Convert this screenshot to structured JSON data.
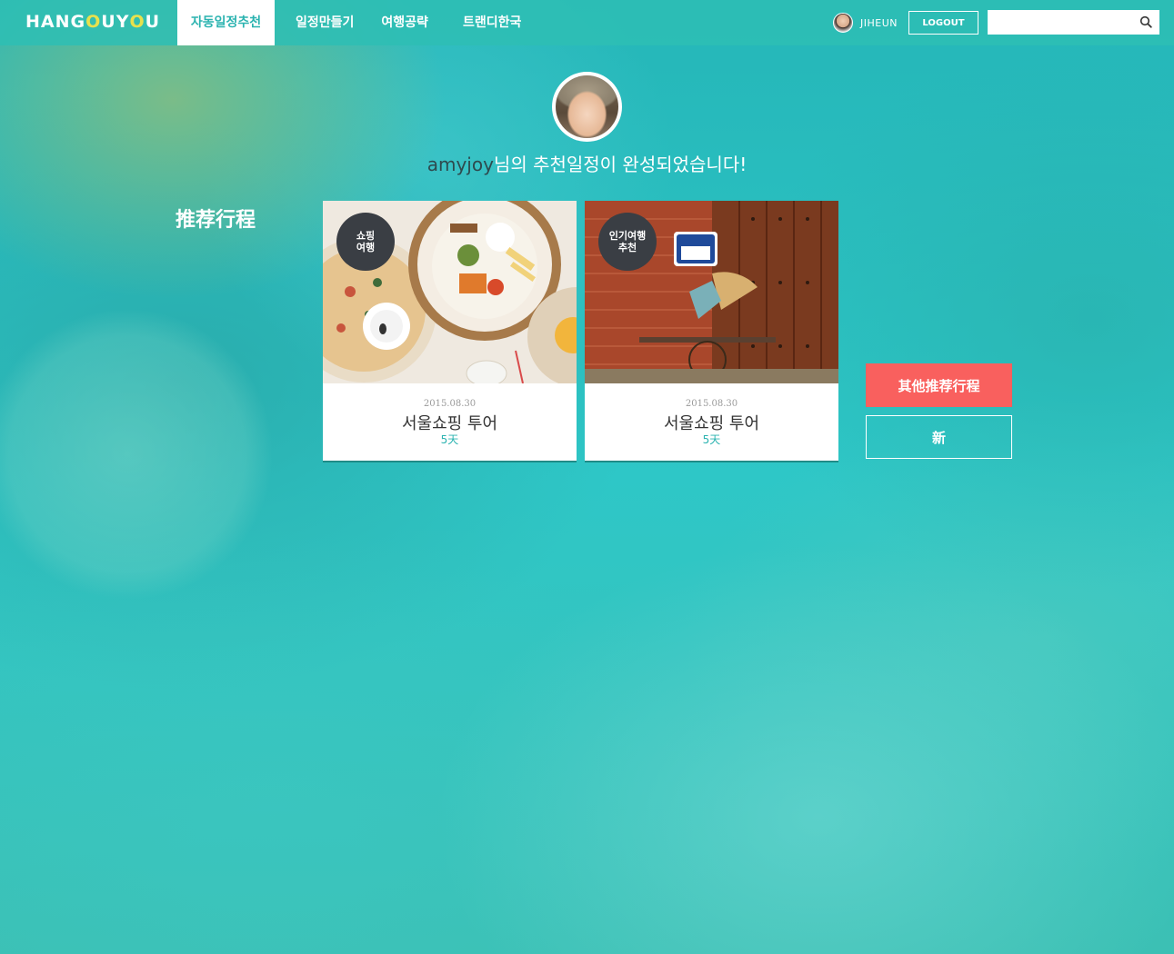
{
  "header": {
    "logo": {
      "part1": "HANG",
      "o1": "O",
      "part2": "UY",
      "o2": "O",
      "part3": "U"
    },
    "nav": [
      {
        "label": "자동일정추천",
        "active": true
      },
      {
        "label": "일정만들기"
      },
      {
        "label": "여행공략"
      },
      {
        "label": "트랜디한국"
      }
    ],
    "user": {
      "name": "JIHEUN"
    },
    "logout_label": "LOGOUT",
    "search": {
      "value": "",
      "placeholder": ""
    }
  },
  "profile": {
    "username": "amyjoy",
    "message": "님의 추천일정이 완성되었습니다!"
  },
  "section_title": "推荐行程",
  "cards": [
    {
      "badge": "쇼핑\n여행",
      "date": "2015.08.30",
      "title": "서울쇼핑 투어",
      "days": "5天"
    },
    {
      "badge": "인기여행\n추천",
      "date": "2015.08.30",
      "title": "서울쇼핑 투어",
      "days": "5天"
    }
  ],
  "buttons": {
    "other_label": "其他推荐行程",
    "new_label": "新"
  },
  "colors": {
    "accent": "#2bb3b0",
    "primary_button": "#f9605e",
    "badge": "#3a3e44",
    "logo_o": "#e8e14d"
  }
}
